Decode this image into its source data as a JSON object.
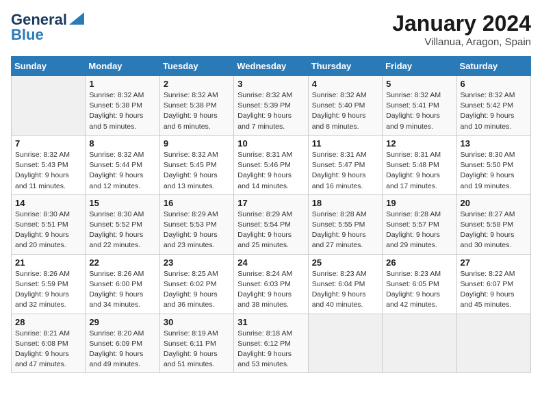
{
  "header": {
    "logo_line1": "General",
    "logo_line2": "Blue",
    "month": "January 2024",
    "location": "Villanua, Aragon, Spain"
  },
  "weekdays": [
    "Sunday",
    "Monday",
    "Tuesday",
    "Wednesday",
    "Thursday",
    "Friday",
    "Saturday"
  ],
  "weeks": [
    [
      {
        "day": "",
        "info": ""
      },
      {
        "day": "1",
        "info": "Sunrise: 8:32 AM\nSunset: 5:38 PM\nDaylight: 9 hours\nand 5 minutes."
      },
      {
        "day": "2",
        "info": "Sunrise: 8:32 AM\nSunset: 5:38 PM\nDaylight: 9 hours\nand 6 minutes."
      },
      {
        "day": "3",
        "info": "Sunrise: 8:32 AM\nSunset: 5:39 PM\nDaylight: 9 hours\nand 7 minutes."
      },
      {
        "day": "4",
        "info": "Sunrise: 8:32 AM\nSunset: 5:40 PM\nDaylight: 9 hours\nand 8 minutes."
      },
      {
        "day": "5",
        "info": "Sunrise: 8:32 AM\nSunset: 5:41 PM\nDaylight: 9 hours\nand 9 minutes."
      },
      {
        "day": "6",
        "info": "Sunrise: 8:32 AM\nSunset: 5:42 PM\nDaylight: 9 hours\nand 10 minutes."
      }
    ],
    [
      {
        "day": "7",
        "info": "Sunrise: 8:32 AM\nSunset: 5:43 PM\nDaylight: 9 hours\nand 11 minutes."
      },
      {
        "day": "8",
        "info": "Sunrise: 8:32 AM\nSunset: 5:44 PM\nDaylight: 9 hours\nand 12 minutes."
      },
      {
        "day": "9",
        "info": "Sunrise: 8:32 AM\nSunset: 5:45 PM\nDaylight: 9 hours\nand 13 minutes."
      },
      {
        "day": "10",
        "info": "Sunrise: 8:31 AM\nSunset: 5:46 PM\nDaylight: 9 hours\nand 14 minutes."
      },
      {
        "day": "11",
        "info": "Sunrise: 8:31 AM\nSunset: 5:47 PM\nDaylight: 9 hours\nand 16 minutes."
      },
      {
        "day": "12",
        "info": "Sunrise: 8:31 AM\nSunset: 5:48 PM\nDaylight: 9 hours\nand 17 minutes."
      },
      {
        "day": "13",
        "info": "Sunrise: 8:30 AM\nSunset: 5:50 PM\nDaylight: 9 hours\nand 19 minutes."
      }
    ],
    [
      {
        "day": "14",
        "info": "Sunrise: 8:30 AM\nSunset: 5:51 PM\nDaylight: 9 hours\nand 20 minutes."
      },
      {
        "day": "15",
        "info": "Sunrise: 8:30 AM\nSunset: 5:52 PM\nDaylight: 9 hours\nand 22 minutes."
      },
      {
        "day": "16",
        "info": "Sunrise: 8:29 AM\nSunset: 5:53 PM\nDaylight: 9 hours\nand 23 minutes."
      },
      {
        "day": "17",
        "info": "Sunrise: 8:29 AM\nSunset: 5:54 PM\nDaylight: 9 hours\nand 25 minutes."
      },
      {
        "day": "18",
        "info": "Sunrise: 8:28 AM\nSunset: 5:55 PM\nDaylight: 9 hours\nand 27 minutes."
      },
      {
        "day": "19",
        "info": "Sunrise: 8:28 AM\nSunset: 5:57 PM\nDaylight: 9 hours\nand 29 minutes."
      },
      {
        "day": "20",
        "info": "Sunrise: 8:27 AM\nSunset: 5:58 PM\nDaylight: 9 hours\nand 30 minutes."
      }
    ],
    [
      {
        "day": "21",
        "info": "Sunrise: 8:26 AM\nSunset: 5:59 PM\nDaylight: 9 hours\nand 32 minutes."
      },
      {
        "day": "22",
        "info": "Sunrise: 8:26 AM\nSunset: 6:00 PM\nDaylight: 9 hours\nand 34 minutes."
      },
      {
        "day": "23",
        "info": "Sunrise: 8:25 AM\nSunset: 6:02 PM\nDaylight: 9 hours\nand 36 minutes."
      },
      {
        "day": "24",
        "info": "Sunrise: 8:24 AM\nSunset: 6:03 PM\nDaylight: 9 hours\nand 38 minutes."
      },
      {
        "day": "25",
        "info": "Sunrise: 8:23 AM\nSunset: 6:04 PM\nDaylight: 9 hours\nand 40 minutes."
      },
      {
        "day": "26",
        "info": "Sunrise: 8:23 AM\nSunset: 6:05 PM\nDaylight: 9 hours\nand 42 minutes."
      },
      {
        "day": "27",
        "info": "Sunrise: 8:22 AM\nSunset: 6:07 PM\nDaylight: 9 hours\nand 45 minutes."
      }
    ],
    [
      {
        "day": "28",
        "info": "Sunrise: 8:21 AM\nSunset: 6:08 PM\nDaylight: 9 hours\nand 47 minutes."
      },
      {
        "day": "29",
        "info": "Sunrise: 8:20 AM\nSunset: 6:09 PM\nDaylight: 9 hours\nand 49 minutes."
      },
      {
        "day": "30",
        "info": "Sunrise: 8:19 AM\nSunset: 6:11 PM\nDaylight: 9 hours\nand 51 minutes."
      },
      {
        "day": "31",
        "info": "Sunrise: 8:18 AM\nSunset: 6:12 PM\nDaylight: 9 hours\nand 53 minutes."
      },
      {
        "day": "",
        "info": ""
      },
      {
        "day": "",
        "info": ""
      },
      {
        "day": "",
        "info": ""
      }
    ]
  ]
}
